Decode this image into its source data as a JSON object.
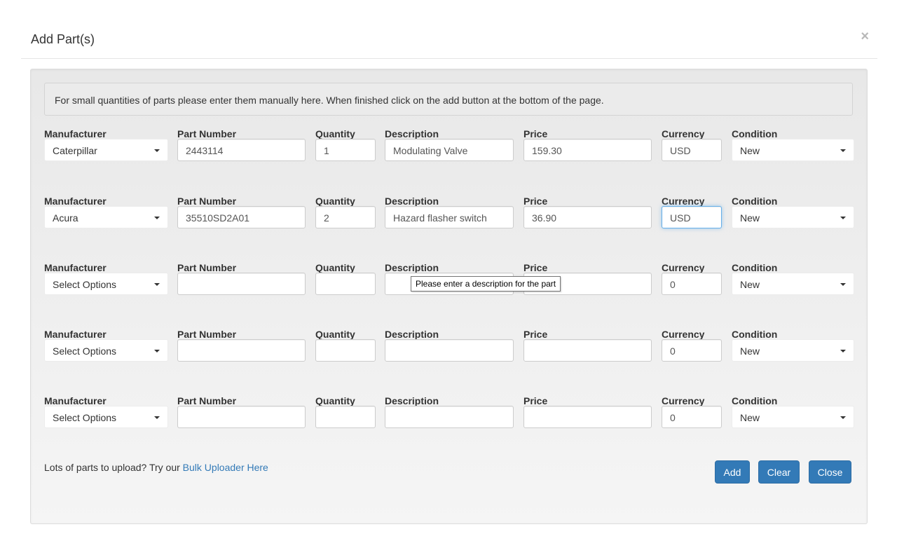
{
  "modal": {
    "title": "Add Part(s)",
    "close_glyph": "×"
  },
  "info": "For small quantities of parts please enter them manually here. When finished click on the add button at the bottom of the page.",
  "labels": {
    "manufacturer": "Manufacturer",
    "part_number": "Part Number",
    "quantity": "Quantity",
    "description": "Description",
    "price": "Price",
    "currency": "Currency",
    "condition": "Condition"
  },
  "rows": [
    {
      "manufacturer": "Caterpillar",
      "part_number": "2443114",
      "quantity": "1",
      "description": "Modulating Valve",
      "price": "159.30",
      "currency": "USD",
      "condition": "New"
    },
    {
      "manufacturer": "Acura",
      "part_number": "35510SD2A01",
      "quantity": "2",
      "description": "Hazard flasher switch",
      "price": "36.90",
      "currency": "USD",
      "condition": "New"
    },
    {
      "manufacturer": "Select Options",
      "part_number": "",
      "quantity": "",
      "description": "",
      "price": "",
      "currency": "0",
      "condition": "New"
    },
    {
      "manufacturer": "Select Options",
      "part_number": "",
      "quantity": "",
      "description": "",
      "price": "",
      "currency": "0",
      "condition": "New"
    },
    {
      "manufacturer": "Select Options",
      "part_number": "",
      "quantity": "",
      "description": "",
      "price": "",
      "currency": "0",
      "condition": "New"
    }
  ],
  "tooltip": "Please enter a description for the part",
  "footer": {
    "prompt": "Lots of parts to upload? Try our ",
    "link": "Bulk Uploader Here"
  },
  "buttons": {
    "add": "Add",
    "clear": "Clear",
    "close": "Close"
  },
  "colors": {
    "primary": "#337ab7",
    "focus": "#66afe9"
  }
}
